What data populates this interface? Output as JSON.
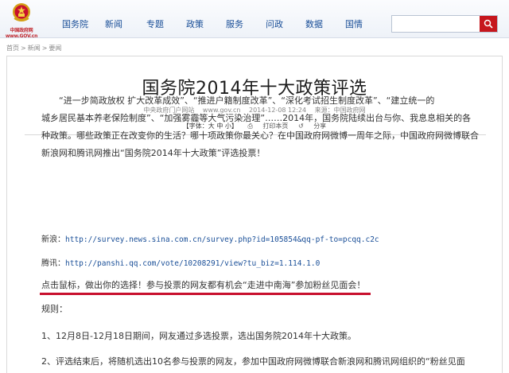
{
  "header": {
    "logo_text": "中国政府网 www.GOV.cn",
    "nav": [
      "国务院",
      "新闻",
      "专题",
      "政策",
      "服务",
      "问政",
      "数据",
      "国情"
    ],
    "search_placeholder": ""
  },
  "breadcrumb": [
    "首页",
    "新闻",
    "要闻"
  ],
  "article": {
    "title": "国务院2014年十大政策评选",
    "source_site": "中央政府门户网站",
    "site_url": "www.gov.cn",
    "datetime": "2014-12-08 12:24",
    "source_label": "来源：中国政府网",
    "font_label": "【字体：大 中 小】",
    "print_label": "打印本页",
    "share_label": "分享",
    "para1_lines": [
      "“进一步简政放权 扩大改革成效”、“推进户籍制度改革”、“深化考试招生制度改革”、“建立统一的",
      "城乡居民基本养老保险制度”、“加强雾霾等大气污染治理”……2014年，国务院陆续出台与你、我息息相关的各",
      "种政策。哪些政策正在改变你的生活？哪十项政策你最关心？在中国政府网微博一周年之际，中国政府网微博联合",
      "新浪网和腾讯网推出“国务院2014年十大政策”评选投票！"
    ],
    "sina_label": "新浪：",
    "sina_url": "http://survey.news.sina.com.cn/survey.php?id=105854&dpc=1&qq-pf-to=pcqq.c2c",
    "sina_url_display": "http://survey.news.sina.com.cn/survey.php?id=105854&qq-pf-to=pcqq.c2c",
    "tencent_label": "腾讯：",
    "tencent_url": "http://panshi.qq.com/vote/10208291/view?tu_biz=1.114.1.0",
    "highlight": "点击鼠标，做出你的选择！参与投票的网友都有机会“走进中南海”参加粉丝见面会！",
    "rules_label": "规则：",
    "rule1": "1、12月8日-12月18日期间，网友通过多选投票，选出国务院2014年十大政策。",
    "rule2": "2、评选结束后，将随机选出10名参与投票的网友，参加中国政府网微博联合新浪网和腾讯网组织的“粉丝见面"
  },
  "colors": {
    "nav_link": "#1a4f98",
    "brand_red": "#c6161d",
    "underline_red": "#c8102e"
  }
}
